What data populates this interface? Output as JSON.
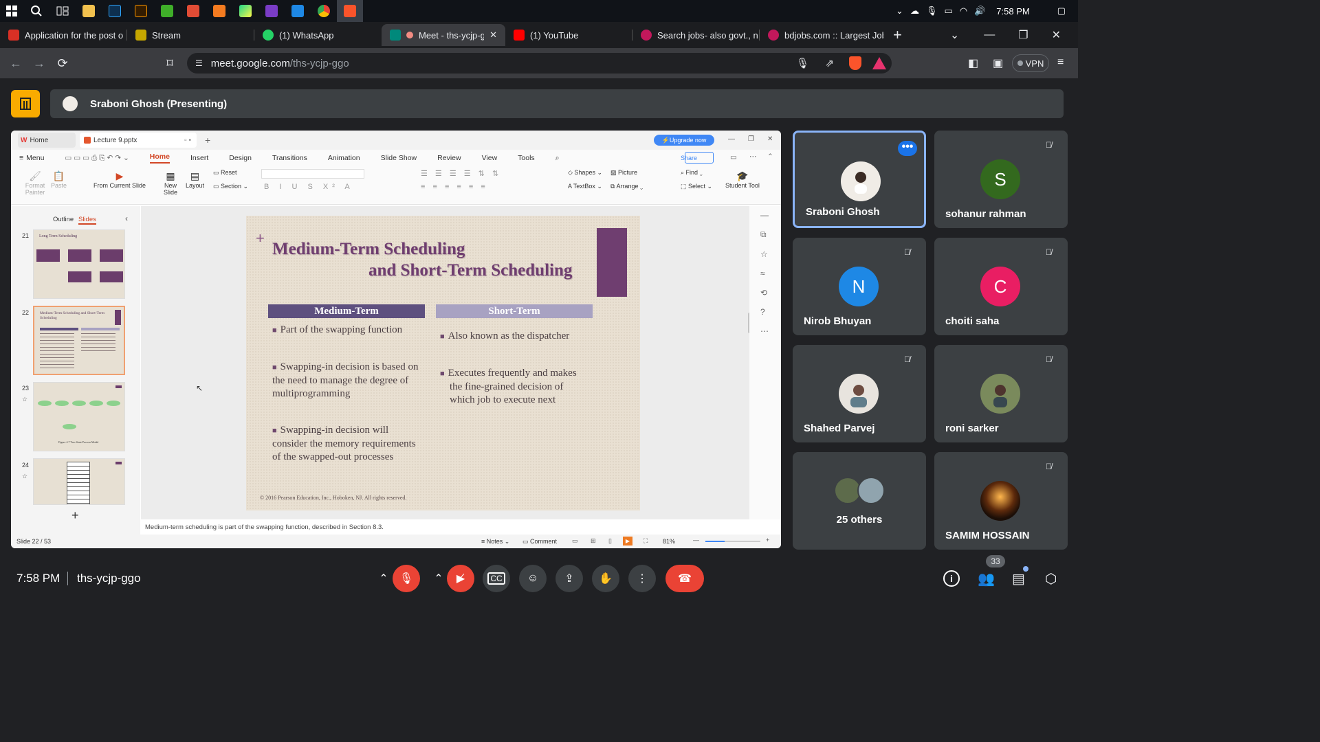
{
  "taskbar": {
    "time": "7:58 PM"
  },
  "tabs": [
    {
      "label": "Application for the post o",
      "color": "#d93025"
    },
    {
      "label": "Stream",
      "color": "#c6a700"
    },
    {
      "label": "(1) WhatsApp",
      "color": "#25d366"
    },
    {
      "label": "Meet - ths-ycjp-gc",
      "color": "#00897b"
    },
    {
      "label": "(1) YouTube",
      "color": "#ff0000"
    },
    {
      "label": "Search jobs- also govt., n",
      "color": "#c2185b"
    },
    {
      "label": "bdjobs.com :: Largest Job",
      "color": "#c2185b"
    }
  ],
  "address": {
    "domain": "meet.google.com",
    "path": "/ths-ycjp-ggo",
    "vpn": "VPN"
  },
  "meet": {
    "presenter_label": "Sraboni Ghosh (Presenting)",
    "time": "7:58 PM",
    "code": "ths-ycjp-ggo",
    "participant_count": "33"
  },
  "wps": {
    "home_tab": "Home",
    "doc_tab": "Lecture 9.pptx",
    "upgrade": "Upgrade now",
    "menu": [
      "Menu",
      "Home",
      "Insert",
      "Design",
      "Transitions",
      "Animation",
      "Slide Show",
      "Review",
      "View",
      "Tools"
    ],
    "share": "Share",
    "ribbon": {
      "format_painter": "Format Painter",
      "paste": "Paste",
      "from_current_slide": "From Current Slide",
      "new_slide": "New Slide",
      "layout": "Layout",
      "reset": "Reset",
      "section": "Section",
      "shapes": "Shapes",
      "picture": "Picture",
      "textbox": "TextBox",
      "arrange": "Arrange",
      "find": "Find",
      "select": "Select",
      "student_tool": "Student Tool"
    },
    "panel_tabs": {
      "outline": "Outline",
      "slides": "Slides"
    },
    "thumbs": [
      {
        "num": "21",
        "title": "Long Term Scheduling"
      },
      {
        "num": "22",
        "title": "Medium-Term Scheduling and Short-Term Scheduling"
      },
      {
        "num": "23",
        "title": "Figure 4.7  Two-State Process Model"
      },
      {
        "num": "24",
        "title": ""
      }
    ],
    "notes": "Medium-term scheduling is part of the swapping function, described in Section 8.3.",
    "status": {
      "slide": "Slide 22 / 53",
      "notes": "Notes",
      "comment": "Comment",
      "zoom": "81%"
    }
  },
  "slide": {
    "title_line1": "Medium-Term Scheduling",
    "title_line2": "and Short-Term Scheduling",
    "col1_head": "Medium-Term",
    "col2_head": "Short-Term",
    "col1_bullets": [
      "Part of the swapping function",
      "Swapping-in decision is based on the need to manage the degree of multiprogramming",
      "Swapping-in decision will consider the memory requirements of the swapped-out processes"
    ],
    "col2_bullets": [
      "Also known as the dispatcher",
      "Executes frequently and makes the fine-grained decision of which job to execute next"
    ],
    "copyright": "© 2016 Pearson Education, Inc., Hoboken, NJ. All rights reserved."
  },
  "participants": [
    {
      "name": "Sraboni Ghosh",
      "initial": "",
      "color": "#f0ece6"
    },
    {
      "name": "sohanur rahman",
      "initial": "S",
      "color": "#33691e"
    },
    {
      "name": "Nirob Bhuyan",
      "initial": "N",
      "color": "#1e88e5"
    },
    {
      "name": "choiti saha",
      "initial": "C",
      "color": "#e91e63"
    },
    {
      "name": "Shahed Parvej",
      "initial": "",
      "color": "#8d6e63"
    },
    {
      "name": "roni sarker",
      "initial": "",
      "color": "#6d7b5a"
    },
    {
      "name": "25 others",
      "initial": "",
      "color": "#78909c"
    },
    {
      "name": "SAMIM HOSSAIN",
      "initial": "",
      "color": "#3e2723"
    }
  ]
}
